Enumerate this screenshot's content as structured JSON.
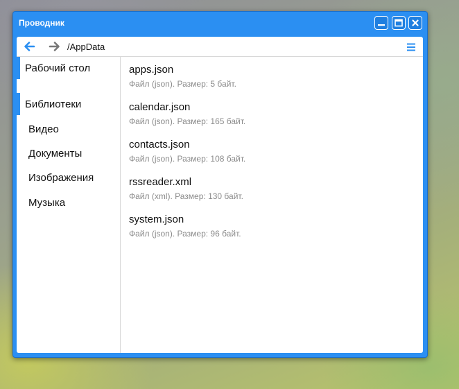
{
  "window": {
    "title": "Проводник"
  },
  "toolbar": {
    "path": "/AppData",
    "back_icon": "arrow-left-icon",
    "forward_icon": "arrow-right-icon",
    "menu_icon": "hamburger-menu-icon"
  },
  "colors": {
    "accent": "#2b8ff2",
    "back_arrow": "#2b8ff2",
    "forward_arrow": "#777777"
  },
  "sidebar": {
    "items": [
      {
        "label": "Рабочий стол",
        "type": "heading",
        "active": true
      },
      {
        "label": "Библиотеки",
        "type": "heading",
        "active": true
      },
      {
        "label": "Видео",
        "type": "sub",
        "active": false
      },
      {
        "label": "Документы",
        "type": "sub",
        "active": false
      },
      {
        "label": "Изображения",
        "type": "sub",
        "active": false
      },
      {
        "label": "Музыка",
        "type": "sub",
        "active": false
      }
    ]
  },
  "files": [
    {
      "name": "apps.json",
      "meta": "Файл (json). Размер: 5 байт."
    },
    {
      "name": "calendar.json",
      "meta": "Файл (json). Размер: 165 байт."
    },
    {
      "name": "contacts.json",
      "meta": "Файл (json). Размер: 108 байт."
    },
    {
      "name": "rssreader.xml",
      "meta": "Файл (xml). Размер: 130 байт."
    },
    {
      "name": "system.json",
      "meta": "Файл (json). Размер: 96 байт."
    }
  ]
}
